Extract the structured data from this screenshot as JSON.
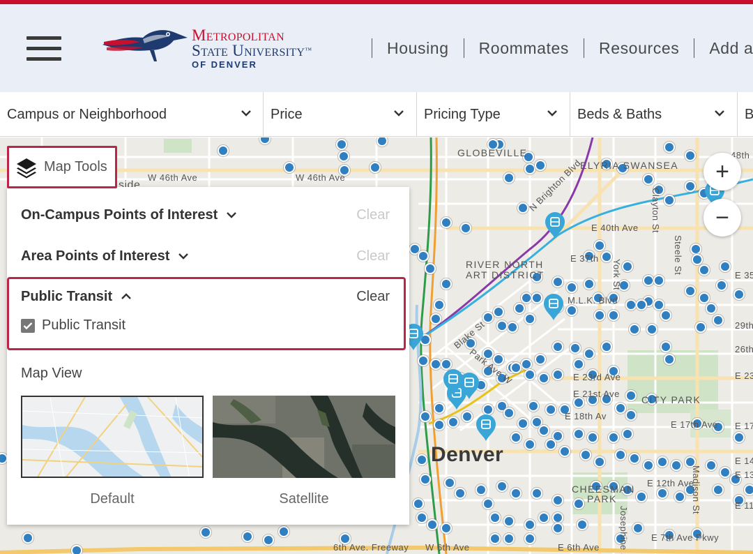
{
  "header": {
    "logo": {
      "line1": "Metropolitan",
      "line2": "State University",
      "trademark": "™",
      "line3": "OF DENVER"
    },
    "nav": [
      {
        "label": "Housing"
      },
      {
        "label": "Roommates"
      },
      {
        "label": "Resources"
      },
      {
        "label": "Add a"
      }
    ]
  },
  "filters": [
    {
      "label": "Campus or Neighborhood"
    },
    {
      "label": "Price"
    },
    {
      "label": "Pricing Type"
    },
    {
      "label": "Beds & Baths"
    },
    {
      "label": "B"
    }
  ],
  "map": {
    "labels": [
      "GLOBEVILLE",
      "ELYRIA SWANSEA",
      "W 46th Ave",
      "W 46th Ave",
      "side",
      "N Brighton Blvd",
      "E 40th Ave",
      "RIVER NORTH",
      "ART DISTRICT",
      "E 37th",
      "M.L.K. Blvd",
      "CITY PARK",
      "E 23rd Ave",
      "E 21st Ave",
      "E 18th Av",
      "E 17th Ave",
      "Denver",
      "CHEESMAN",
      "PARK",
      "E 12th Ave",
      "E 7th Ave Pkwy",
      "E 6th Ave",
      "W 6th Ave",
      "6th Ave. Freeway",
      "Blake St",
      "Park Ave W",
      "York St",
      "Steele St",
      "Madison St",
      "Josephine St",
      "Clayton St",
      "48th",
      "E 35",
      "29th",
      "26th",
      "E 23",
      "E 17",
      "E 14",
      "E 13",
      "E 11"
    ],
    "zoom_in": "+",
    "zoom_out": "−"
  },
  "map_tools": {
    "button_label": "Map Tools",
    "sections": [
      {
        "title": "On-Campus Points of Interest",
        "clear": "Clear",
        "expanded": false
      },
      {
        "title": "Area Points of Interest",
        "clear": "Clear",
        "expanded": false
      },
      {
        "title": "Public Transit",
        "clear": "Clear",
        "expanded": true
      }
    ],
    "public_transit_option": {
      "label": "Public Transit",
      "checked": true
    },
    "map_view": {
      "title": "Map View",
      "options": [
        {
          "label": "Default",
          "selected": true
        },
        {
          "label": "Satellite",
          "selected": false
        }
      ]
    }
  },
  "colors": {
    "accent": "#c8102e",
    "brand_blue": "#1f3a6e",
    "highlight_border": "#b8264a",
    "marker": "#2f7fc1",
    "transit_marker": "#3aa6d8"
  }
}
